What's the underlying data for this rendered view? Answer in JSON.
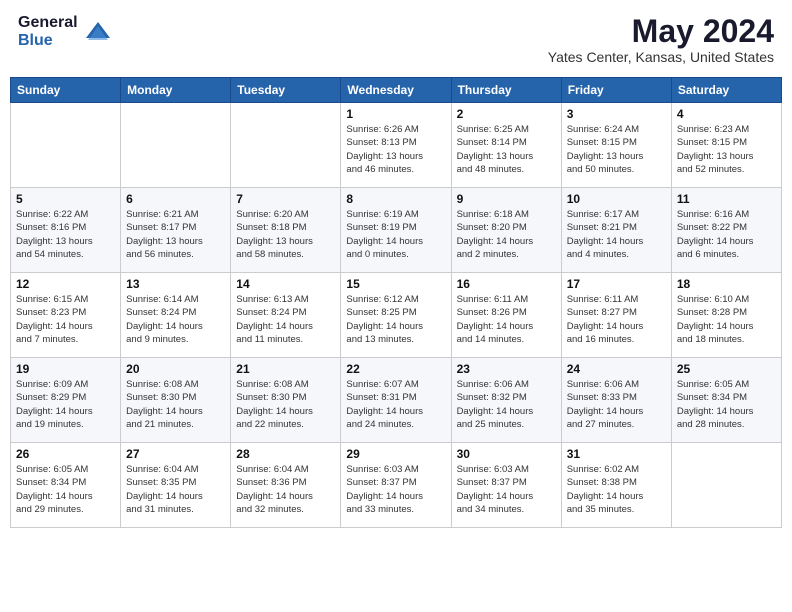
{
  "logo": {
    "general": "General",
    "blue": "Blue"
  },
  "title": {
    "month_year": "May 2024",
    "location": "Yates Center, Kansas, United States"
  },
  "weekdays": [
    "Sunday",
    "Monday",
    "Tuesday",
    "Wednesday",
    "Thursday",
    "Friday",
    "Saturday"
  ],
  "weeks": [
    [
      {
        "day": "",
        "info": ""
      },
      {
        "day": "",
        "info": ""
      },
      {
        "day": "",
        "info": ""
      },
      {
        "day": "1",
        "info": "Sunrise: 6:26 AM\nSunset: 8:13 PM\nDaylight: 13 hours\nand 46 minutes."
      },
      {
        "day": "2",
        "info": "Sunrise: 6:25 AM\nSunset: 8:14 PM\nDaylight: 13 hours\nand 48 minutes."
      },
      {
        "day": "3",
        "info": "Sunrise: 6:24 AM\nSunset: 8:15 PM\nDaylight: 13 hours\nand 50 minutes."
      },
      {
        "day": "4",
        "info": "Sunrise: 6:23 AM\nSunset: 8:15 PM\nDaylight: 13 hours\nand 52 minutes."
      }
    ],
    [
      {
        "day": "5",
        "info": "Sunrise: 6:22 AM\nSunset: 8:16 PM\nDaylight: 13 hours\nand 54 minutes."
      },
      {
        "day": "6",
        "info": "Sunrise: 6:21 AM\nSunset: 8:17 PM\nDaylight: 13 hours\nand 56 minutes."
      },
      {
        "day": "7",
        "info": "Sunrise: 6:20 AM\nSunset: 8:18 PM\nDaylight: 13 hours\nand 58 minutes."
      },
      {
        "day": "8",
        "info": "Sunrise: 6:19 AM\nSunset: 8:19 PM\nDaylight: 14 hours\nand 0 minutes."
      },
      {
        "day": "9",
        "info": "Sunrise: 6:18 AM\nSunset: 8:20 PM\nDaylight: 14 hours\nand 2 minutes."
      },
      {
        "day": "10",
        "info": "Sunrise: 6:17 AM\nSunset: 8:21 PM\nDaylight: 14 hours\nand 4 minutes."
      },
      {
        "day": "11",
        "info": "Sunrise: 6:16 AM\nSunset: 8:22 PM\nDaylight: 14 hours\nand 6 minutes."
      }
    ],
    [
      {
        "day": "12",
        "info": "Sunrise: 6:15 AM\nSunset: 8:23 PM\nDaylight: 14 hours\nand 7 minutes."
      },
      {
        "day": "13",
        "info": "Sunrise: 6:14 AM\nSunset: 8:24 PM\nDaylight: 14 hours\nand 9 minutes."
      },
      {
        "day": "14",
        "info": "Sunrise: 6:13 AM\nSunset: 8:24 PM\nDaylight: 14 hours\nand 11 minutes."
      },
      {
        "day": "15",
        "info": "Sunrise: 6:12 AM\nSunset: 8:25 PM\nDaylight: 14 hours\nand 13 minutes."
      },
      {
        "day": "16",
        "info": "Sunrise: 6:11 AM\nSunset: 8:26 PM\nDaylight: 14 hours\nand 14 minutes."
      },
      {
        "day": "17",
        "info": "Sunrise: 6:11 AM\nSunset: 8:27 PM\nDaylight: 14 hours\nand 16 minutes."
      },
      {
        "day": "18",
        "info": "Sunrise: 6:10 AM\nSunset: 8:28 PM\nDaylight: 14 hours\nand 18 minutes."
      }
    ],
    [
      {
        "day": "19",
        "info": "Sunrise: 6:09 AM\nSunset: 8:29 PM\nDaylight: 14 hours\nand 19 minutes."
      },
      {
        "day": "20",
        "info": "Sunrise: 6:08 AM\nSunset: 8:30 PM\nDaylight: 14 hours\nand 21 minutes."
      },
      {
        "day": "21",
        "info": "Sunrise: 6:08 AM\nSunset: 8:30 PM\nDaylight: 14 hours\nand 22 minutes."
      },
      {
        "day": "22",
        "info": "Sunrise: 6:07 AM\nSunset: 8:31 PM\nDaylight: 14 hours\nand 24 minutes."
      },
      {
        "day": "23",
        "info": "Sunrise: 6:06 AM\nSunset: 8:32 PM\nDaylight: 14 hours\nand 25 minutes."
      },
      {
        "day": "24",
        "info": "Sunrise: 6:06 AM\nSunset: 8:33 PM\nDaylight: 14 hours\nand 27 minutes."
      },
      {
        "day": "25",
        "info": "Sunrise: 6:05 AM\nSunset: 8:34 PM\nDaylight: 14 hours\nand 28 minutes."
      }
    ],
    [
      {
        "day": "26",
        "info": "Sunrise: 6:05 AM\nSunset: 8:34 PM\nDaylight: 14 hours\nand 29 minutes."
      },
      {
        "day": "27",
        "info": "Sunrise: 6:04 AM\nSunset: 8:35 PM\nDaylight: 14 hours\nand 31 minutes."
      },
      {
        "day": "28",
        "info": "Sunrise: 6:04 AM\nSunset: 8:36 PM\nDaylight: 14 hours\nand 32 minutes."
      },
      {
        "day": "29",
        "info": "Sunrise: 6:03 AM\nSunset: 8:37 PM\nDaylight: 14 hours\nand 33 minutes."
      },
      {
        "day": "30",
        "info": "Sunrise: 6:03 AM\nSunset: 8:37 PM\nDaylight: 14 hours\nand 34 minutes."
      },
      {
        "day": "31",
        "info": "Sunrise: 6:02 AM\nSunset: 8:38 PM\nDaylight: 14 hours\nand 35 minutes."
      },
      {
        "day": "",
        "info": ""
      }
    ]
  ]
}
